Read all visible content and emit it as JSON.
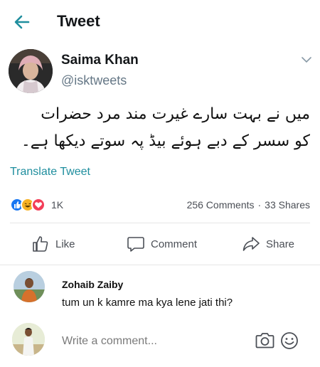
{
  "header": {
    "title": "Tweet",
    "back_icon": "arrow-left-icon",
    "accent": "#1f8e9e"
  },
  "tweet": {
    "author_name": "Saima Khan",
    "author_handle": "@isktweets",
    "text_lines": [
      "میں نے بہت سارے غیرت مند مرد حضرات",
      "کو سسر کے دبے ہوئے بیڈ پہ سوتے دیکھا ہے۔"
    ],
    "translate_label": "Translate Tweet"
  },
  "engagement": {
    "reaction_count": "1K",
    "comments": "256 Comments",
    "separator": "·",
    "shares": "33 Shares",
    "reaction_icons": [
      "like-reaction-icon",
      "haha-reaction-icon",
      "love-reaction-icon"
    ]
  },
  "actions": {
    "like": "Like",
    "comment": "Comment",
    "share": "Share"
  },
  "comment": {
    "author": "Zohaib Zaiby",
    "text": "tum un k kamre ma kya lene jati thi?"
  },
  "composer": {
    "placeholder": "Write a comment...",
    "icons": [
      "camera-icon",
      "emoji-icon"
    ]
  }
}
